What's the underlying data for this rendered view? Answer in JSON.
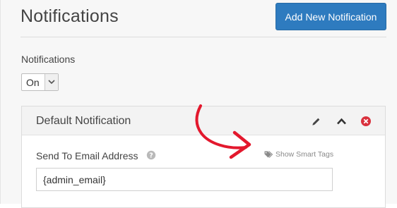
{
  "page": {
    "title": "Notifications",
    "add_button_label": "Add New Notification"
  },
  "notifications_toggle": {
    "label": "Notifications",
    "selected": "On"
  },
  "notification_card": {
    "title": "Default Notification",
    "icons": [
      "pencil-icon",
      "chevron-up-icon",
      "close-circle-icon"
    ],
    "send_to": {
      "label": "Send To Email Address",
      "value": "{admin_email}",
      "smart_tags_label": "Show Smart Tags"
    }
  },
  "colors": {
    "accent_button": "#2e7bbf",
    "annotation_arrow": "#e3182d",
    "delete_icon": "#d9313d"
  }
}
